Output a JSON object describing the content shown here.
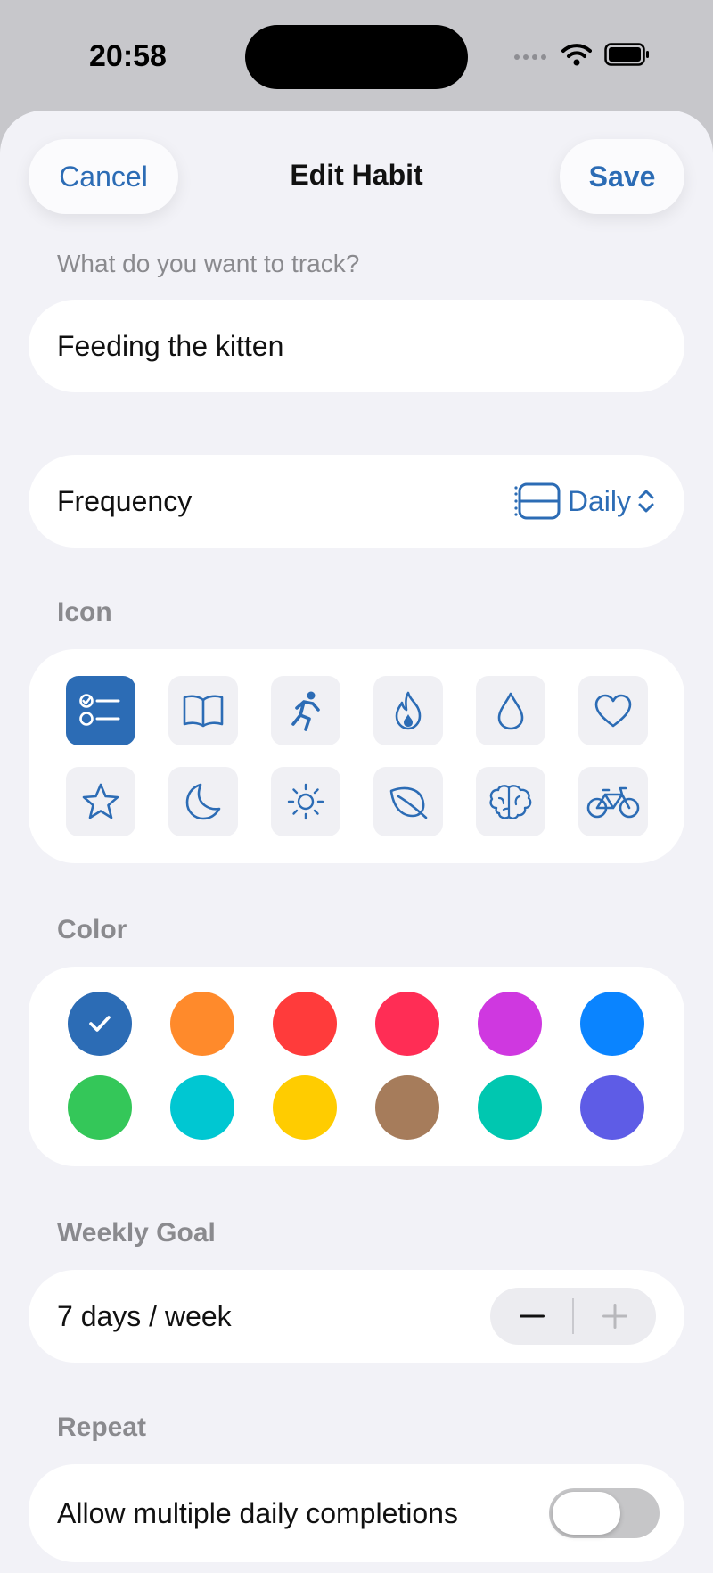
{
  "status_bar": {
    "time": "20:58"
  },
  "nav": {
    "cancel_label": "Cancel",
    "title": "Edit Habit",
    "save_label": "Save"
  },
  "habit": {
    "prompt": "What do you want to track?",
    "name_value": "Feeding the kitten"
  },
  "frequency": {
    "label": "Frequency",
    "value": "Daily"
  },
  "icons": {
    "section_title": "Icon",
    "items": [
      "checklist-icon",
      "book-icon",
      "running-figure-icon",
      "flame-icon",
      "drop-icon",
      "heart-icon",
      "star-icon",
      "moon-icon",
      "sun-icon",
      "leaf-icon",
      "brain-icon",
      "bicycle-icon"
    ],
    "selected": "checklist-icon"
  },
  "colors": {
    "section_title": "Color",
    "swatches": [
      "#2c6cb5",
      "#ff8a2b",
      "#ff3b3b",
      "#ff2d55",
      "#cf38e0",
      "#0a84ff",
      "#34c759",
      "#00c7d2",
      "#ffcc00",
      "#a67c5b",
      "#00c7b0",
      "#5e5ce6"
    ],
    "selected_index": 0
  },
  "accent_color": "#2c6cb5",
  "weekly_goal": {
    "section_title": "Weekly Goal",
    "value": "7 days / week"
  },
  "repeat": {
    "section_title": "Repeat",
    "label": "Allow multiple daily completions",
    "enabled": false
  }
}
